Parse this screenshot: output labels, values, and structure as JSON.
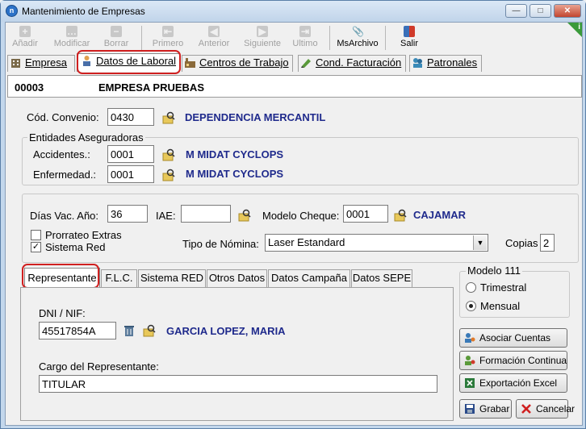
{
  "window": {
    "title": "Mantenimiento de Empresas",
    "app_icon": "n"
  },
  "toolbar": {
    "anadir": "Añadir",
    "modificar": "Modificar",
    "borrar": "Borrar",
    "primero": "Primero",
    "anterior": "Anterior",
    "siguiente": "Siguiente",
    "ultimo": "Ultimo",
    "msarchivo": "MsArchivo",
    "salir": "Salir"
  },
  "main_tabs": {
    "empresa": "Empresa",
    "datos_laboral": "Datos de Laboral",
    "centros": "Centros de Trabajo",
    "facturacion": "Cond. Facturación",
    "patronales": "Patronales"
  },
  "header": {
    "code": "00003",
    "name": "EMPRESA PRUEBAS"
  },
  "convenio": {
    "label": "Cód. Convenio:",
    "value": "0430",
    "desc": "DEPENDENCIA MERCANTIL"
  },
  "entidades": {
    "title": "Entidades Aseguradoras",
    "accidentes_label": "Accidentes.:",
    "accidentes_value": "0001",
    "accidentes_desc": "M MIDAT CYCLOPS",
    "enfermedad_label": "Enfermedad.:",
    "enfermedad_value": "0001",
    "enfermedad_desc": "M MIDAT CYCLOPS"
  },
  "misc": {
    "dias_label": "Días Vac. Año:",
    "dias_value": "36",
    "iae_label": "IAE:",
    "iae_value": "",
    "cheque_label": "Modelo Cheque:",
    "cheque_value": "0001",
    "cheque_desc": "CAJAMAR",
    "prorrateo_label": "Prorrateo Extras",
    "sistema_red_label": "Sistema Red",
    "nomina_label": "Tipo de Nómina:",
    "nomina_value": "Laser Estandard",
    "copias_label": "Copias",
    "copias_value": "2"
  },
  "sub_tabs": {
    "representante": "Representante",
    "flc": "F.L.C.",
    "sistema_red": "Sistema RED",
    "otros": "Otros Datos",
    "campana": "Datos Campaña",
    "sepe": "Datos SEPE"
  },
  "representante": {
    "dni_label": "DNI / NIF:",
    "dni_value": "45517854A",
    "nombre": "GARCIA LOPEZ, MARIA",
    "cargo_label": "Cargo del Representante:",
    "cargo_value": "TITULAR"
  },
  "modelo111": {
    "title": "Modelo 111",
    "trimestral": "Trimestral",
    "mensual": "Mensual"
  },
  "buttons": {
    "asociar": "Asociar Cuentas",
    "formacion": "Formación Continua",
    "exportacion": "Exportación Excel",
    "grabar": "Grabar",
    "cancelar": "Cancelar"
  }
}
